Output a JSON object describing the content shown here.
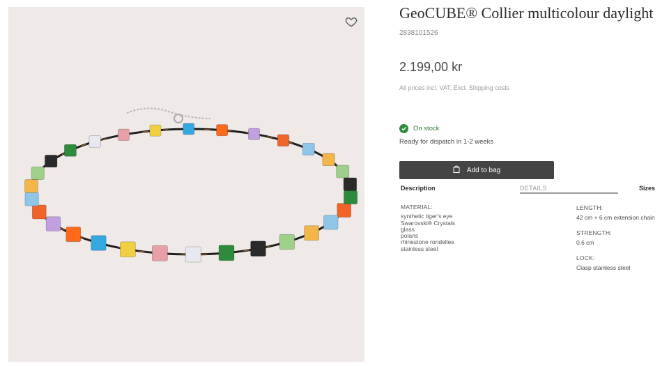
{
  "product": {
    "title": "GeoCUBE® Collier multicolour daylight",
    "sku": "2838101526",
    "price": "2.199,00 kr",
    "vat_note": "All prices incl. VAT. Excl. Shipping costs",
    "stock_status": "On stock",
    "dispatch": "Ready for dispatch in 1-2 weeks",
    "add_to_bag": "Add to bag",
    "image_alt": "multicolour cube necklace"
  },
  "tabs": {
    "description": "Description",
    "details": "DETAILS",
    "sizes": "Sizes"
  },
  "details": {
    "material_label": "MATERIAL:",
    "materials": [
      "synthetic tiger's eye",
      "Swarovski® Crystals",
      "glass",
      "polaris",
      "rhinestone rondelles",
      "stainless steel"
    ],
    "length_label": "LENGTH:",
    "length_value": "42 cm + 6 cm extension chain",
    "strength_label": "STRENGTH:",
    "strength_value": "0.6 cm",
    "lock_label": "LOCK:",
    "lock_value": "Clasp stainless steel"
  },
  "icons": {
    "wishlist": "heart-icon",
    "stock": "check-circle-icon",
    "bag": "shopping-bag-icon"
  },
  "colors": {
    "image_background": "#efeae8",
    "button": "#444444",
    "in_stock": "#2e8b3c"
  }
}
